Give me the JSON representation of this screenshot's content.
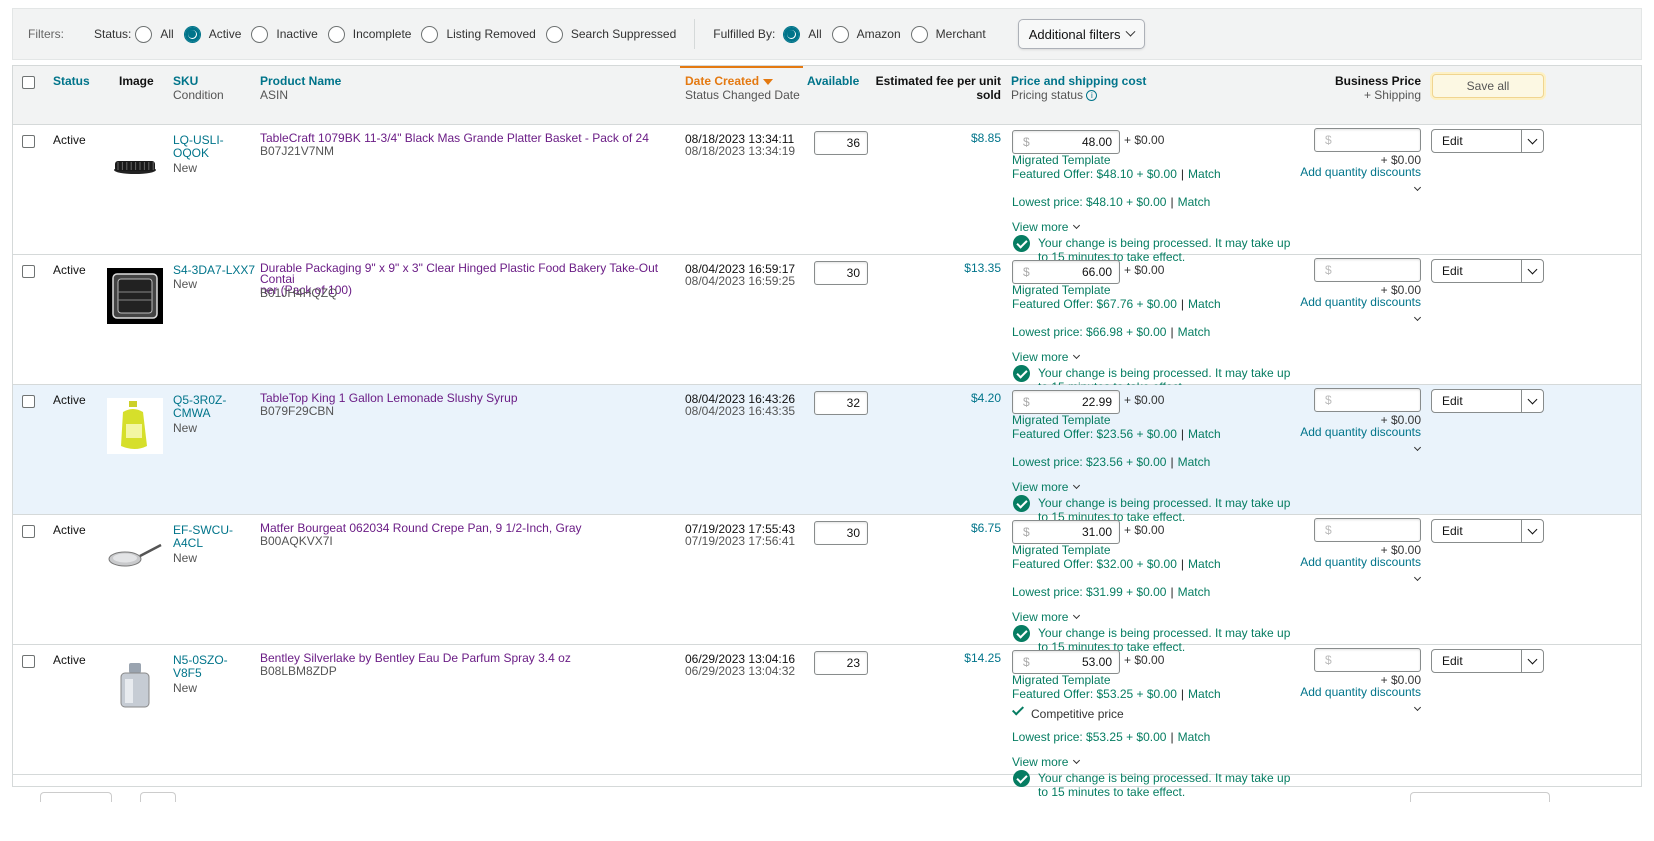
{
  "filters": {
    "label": "Filters:",
    "status_label": "Status:",
    "status_options": [
      "All",
      "Active",
      "Inactive",
      "Incomplete",
      "Listing Removed",
      "Search Suppressed"
    ],
    "status_selected": "Active",
    "fulfilled_label": "Fulfilled By:",
    "fulfilled_options": [
      "All",
      "Amazon",
      "Merchant"
    ],
    "fulfilled_selected": "All",
    "additional_filters": "Additional filters"
  },
  "headers": {
    "status": "Status",
    "image": "Image",
    "sku": "SKU",
    "condition": "Condition",
    "product_name": "Product Name",
    "asin": "ASIN",
    "date_created": "Date Created",
    "status_changed": "Status Changed Date",
    "available": "Available",
    "fee_line1": "Estimated fee per unit",
    "fee_line2": "sold",
    "price": "Price and shipping cost",
    "pricing_status": "Pricing status",
    "business_price": "Business Price",
    "plus_shipping": "+ Shipping",
    "save_all": "Save all"
  },
  "common": {
    "currency": "$",
    "shipping_add": "+ $0.00",
    "migrated": "Migrated Template",
    "match": "Match",
    "view_more": "View more",
    "processing_l1": "Your change is being processed. It may take up",
    "processing_l2": "to 15 minutes to take effect.",
    "add_qty": "Add quantity discounts",
    "edit": "Edit",
    "competitive": "Competitive price"
  },
  "rows": [
    {
      "status": "Active",
      "sku_l1": "LQ-USLI-",
      "sku_l2": "OQOK",
      "condition": "New",
      "name_l1": "TableCraft 1079BK 11-3/4\" Black Mas Grande Platter Basket - Pack of 24",
      "name_l2": "",
      "asin": "B07J21V7NM",
      "date_created": "08/18/2023 13:34:11",
      "date_changed": "08/18/2023 13:34:19",
      "available": "36",
      "fee": "$8.85",
      "price": "48.00",
      "featured": "Featured Offer: $48.10 + $0.00",
      "lowest": "Lowest price: $48.10 + $0.00",
      "image": "basket-image"
    },
    {
      "status": "Active",
      "sku_l1": "S4-3DA7-LXX7",
      "sku_l2": "",
      "condition": "New",
      "name_l1": "Durable Packaging 9\" x 9\" x 3\" Clear Hinged Plastic Food Bakery Take-Out Contai",
      "name_l2": "ner (Pack of 100)",
      "asin": "B01JH4HQZQ",
      "date_created": "08/04/2023 16:59:17",
      "date_changed": "08/04/2023 16:59:25",
      "available": "30",
      "fee": "$13.35",
      "price": "66.00",
      "featured": "Featured Offer: $67.76 + $0.00",
      "lowest": "Lowest price: $66.98 + $0.00",
      "image": "container-image"
    },
    {
      "status": "Active",
      "sku_l1": "Q5-3R0Z-",
      "sku_l2": "CMWA",
      "condition": "New",
      "name_l1": "TableTop King 1 Gallon Lemonade Slushy Syrup",
      "name_l2": "",
      "asin": "B079F29CBN",
      "date_created": "08/04/2023 16:43:26",
      "date_changed": "08/04/2023 16:43:35",
      "available": "32",
      "fee": "$4.20",
      "price": "22.99",
      "featured": "Featured Offer: $23.56 + $0.00",
      "lowest": "Lowest price: $23.56 + $0.00",
      "image": "syrup-image"
    },
    {
      "status": "Active",
      "sku_l1": "EF-SWCU-",
      "sku_l2": "A4CL",
      "condition": "New",
      "name_l1": "Matfer Bourgeat 062034 Round Crepe Pan, 9 1/2-Inch, Gray",
      "name_l2": "",
      "asin": "B00AQKVX7I",
      "date_created": "07/19/2023 17:55:43",
      "date_changed": "07/19/2023 17:56:41",
      "available": "30",
      "fee": "$6.75",
      "price": "31.00",
      "featured": "Featured Offer: $32.00 + $0.00",
      "lowest": "Lowest price: $31.99 + $0.00",
      "image": "pan-image"
    },
    {
      "status": "Active",
      "sku_l1": "N5-0SZO-",
      "sku_l2": "V8F5",
      "condition": "New",
      "name_l1": "Bentley Silverlake by Bentley Eau De Parfum Spray 3.4 oz",
      "name_l2": "",
      "asin": "B08LBM8ZDP",
      "date_created": "06/29/2023 13:04:16",
      "date_changed": "06/29/2023 13:04:32",
      "available": "23",
      "fee": "$14.25",
      "price": "53.00",
      "featured": "Featured Offer: $53.25 + $0.00",
      "lowest": "Lowest price: $53.25 + $0.00",
      "image": "perfume-image"
    }
  ]
}
